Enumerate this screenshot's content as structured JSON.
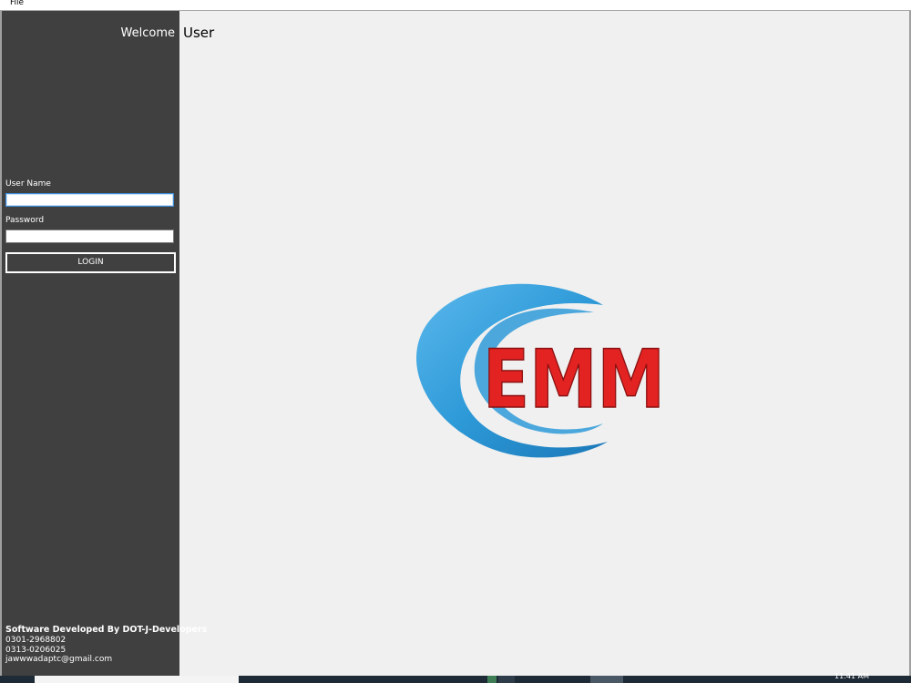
{
  "menubar": {
    "file_label": "File"
  },
  "sidebar": {
    "welcome_label": "Welcome",
    "username_label": "User Name",
    "username_value": "",
    "password_label": "Password",
    "password_value": "",
    "login_label": "LOGIN",
    "developer": {
      "title": "Software Developed By DOT-J-Developers",
      "phone1": "0301-2968802",
      "phone2": "0313-0206025",
      "email": "jawwwadaptc@gmail.com"
    },
    "background_color": "#404040"
  },
  "main": {
    "user_label": "User",
    "logo": {
      "text": "EMM",
      "text_color": "#e32222",
      "swoosh_color": "#2e9ad8"
    }
  },
  "taskbar": {
    "clock": "11:41 AM"
  }
}
